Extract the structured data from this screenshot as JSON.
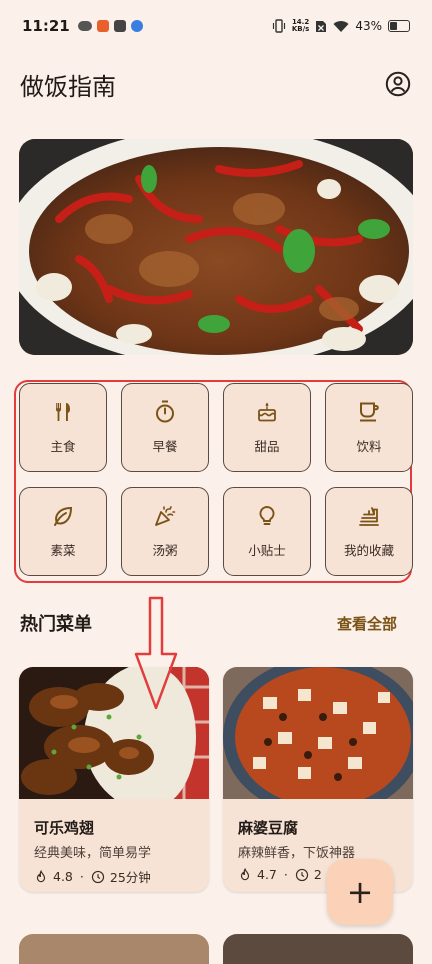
{
  "status_bar": {
    "time": "11:21",
    "net_speed_value": "14.2",
    "net_speed_unit": "KB/s",
    "battery": "43%",
    "battery_level": 0.43
  },
  "app_bar": {
    "title": "做饭指南",
    "account_icon": "account-circle-icon"
  },
  "categories": [
    {
      "label": "主食",
      "icon": "fork-knife-icon"
    },
    {
      "label": "早餐",
      "icon": "timer-icon"
    },
    {
      "label": "甜品",
      "icon": "cake-icon"
    },
    {
      "label": "饮料",
      "icon": "cup-icon"
    },
    {
      "label": "素菜",
      "icon": "leaf-icon"
    },
    {
      "label": "汤粥",
      "icon": "party-popper-icon"
    },
    {
      "label": "小贴士",
      "icon": "lightbulb-icon"
    },
    {
      "label": "我的收藏",
      "icon": "takeout-dining-icon"
    }
  ],
  "popular": {
    "title": "热门菜单",
    "see_all": "查看全部",
    "cards": [
      {
        "title": "可乐鸡翅",
        "subtitle": "经典美味，简单易学",
        "rating": "4.8",
        "time": "25分钟"
      },
      {
        "title": "麻婆豆腐",
        "subtitle": "麻辣鲜香，下饭神器",
        "rating": "4.7",
        "time": "2"
      }
    ]
  },
  "fab": {
    "label": "+"
  },
  "colors": {
    "background": "#fbf1ea",
    "tile": "#f6e3d6",
    "accent": "#7a5316",
    "highlight_frame": "#e23c3c",
    "fab": "#fbd2b7"
  }
}
